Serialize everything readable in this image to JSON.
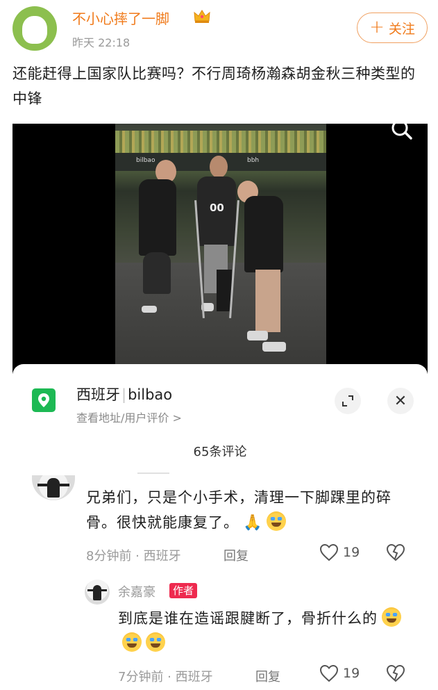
{
  "post": {
    "author": "不小心摔了一脚",
    "time": "昨天 22:18",
    "follow_label": "关注",
    "text": "还能赶得上国家队比赛吗？不行周琦杨瀚森胡金秋三种类型的中锋"
  },
  "photo": {
    "board_text_1": "bilbao",
    "board_text_2": "bbh",
    "jersey_text": "00"
  },
  "location": {
    "country": "西班牙",
    "city": "bilbao",
    "subtitle": "查看地址/用户评价 >",
    "expand_icon": "expand-icon",
    "close_label": "✕"
  },
  "comments_header": "65条评论",
  "comments": [
    {
      "body": "兄弟们，只是个小手术，清理一下脚踝里的碎骨。很快就能康复了。",
      "time": "8分钟前",
      "location": "西班牙",
      "reply_label": "回复",
      "likes": "19"
    },
    {
      "name": "余嘉豪",
      "badge": "作者",
      "body": "到底是谁在造谣跟腱断了，骨折什么的",
      "time": "7分钟前",
      "location": "西班牙",
      "reply_label": "回复",
      "likes": "19"
    }
  ],
  "colors": {
    "accent": "#f07a1a",
    "location_green": "#1db954",
    "author_badge": "#ee2a4f"
  }
}
